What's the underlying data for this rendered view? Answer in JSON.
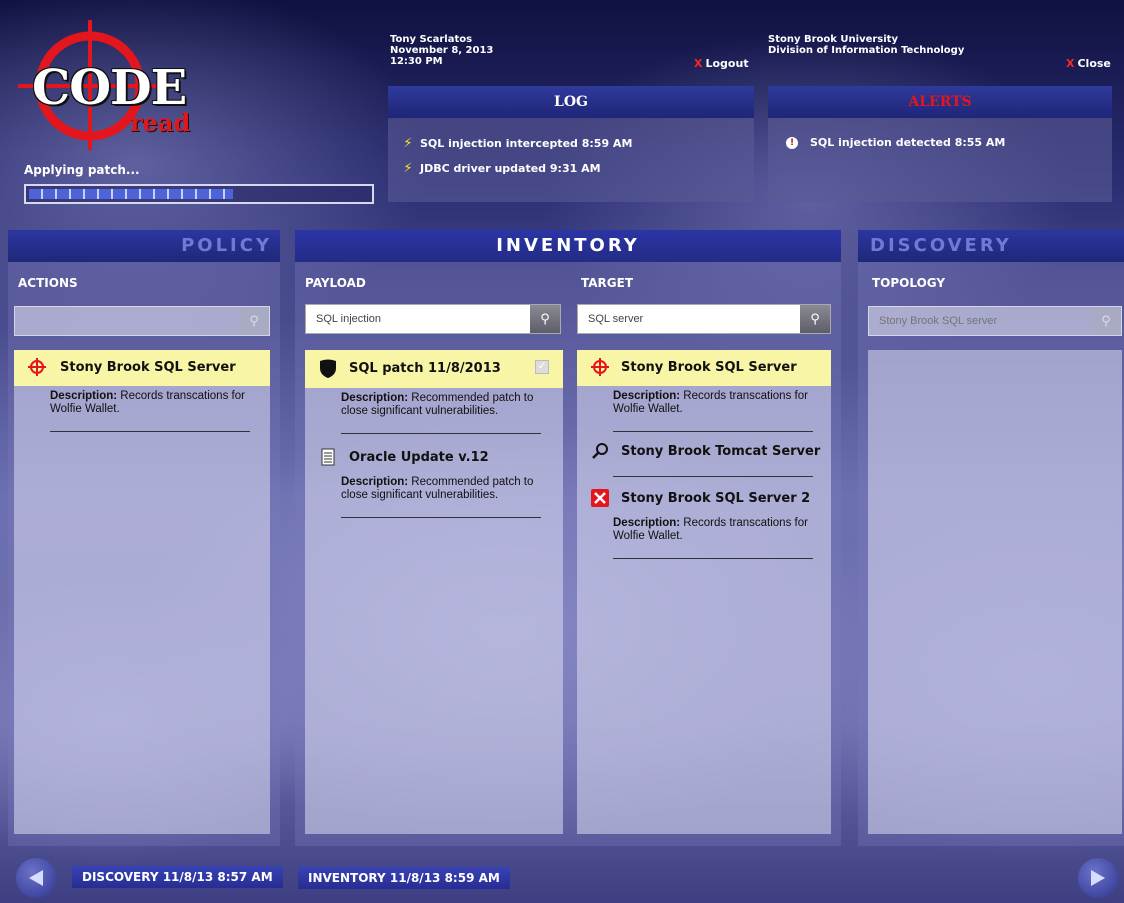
{
  "logo": {
    "word": "CODE",
    "sub": "read"
  },
  "status": {
    "text": "Applying patch...",
    "progress": 0.6
  },
  "user": {
    "name": "Tony Scarlatos",
    "date": "November 8, 2013",
    "time": "12:30 PM",
    "logout_label": "Logout"
  },
  "org": {
    "name": "Stony Brook University",
    "division": "Division of Information Technology",
    "close_label": "Close"
  },
  "log": {
    "title": "LOG",
    "items": [
      {
        "text": "SQL injection intercepted 8:59 AM",
        "icon": "lightning-icon"
      },
      {
        "text": "JDBC driver updated 9:31 AM",
        "icon": "lightning-icon"
      }
    ]
  },
  "alerts": {
    "title": "ALERTS",
    "items": [
      {
        "text": "SQL injection detected 8:55 AM",
        "icon": "alert-icon"
      }
    ]
  },
  "policy": {
    "title": "POLICY",
    "section": "ACTIONS",
    "search_value": "",
    "items": [
      {
        "title": "Stony Brook SQL Server",
        "desc_label": "Description:",
        "desc_text": "Records transcations for Wolfie Wallet."
      }
    ]
  },
  "inventory": {
    "title": "INVENTORY",
    "payload": {
      "section": "PAYLOAD",
      "search_value": "SQL injection",
      "items": [
        {
          "title": "SQL patch 11/8/2013",
          "desc_label": "Description:",
          "desc_text": "Recommended patch to close significant vulnerabilities.",
          "icon": "shield-icon"
        },
        {
          "title": "Oracle Update v.12",
          "desc_label": "Description:",
          "desc_text": "Recommended patch to close significant vulnerabilities.",
          "icon": "document-icon"
        }
      ]
    },
    "target": {
      "section": "TARGET",
      "search_value": "SQL server",
      "items": [
        {
          "title": "Stony Brook SQL Server",
          "desc_label": "Description:",
          "desc_text": "Records transcations for Wolfie Wallet.",
          "icon": "crosshair-icon"
        },
        {
          "title": "Stony Brook Tomcat Server",
          "icon": "magnifier-icon"
        },
        {
          "title": "Stony Brook SQL Server 2",
          "desc_label": "Description:",
          "desc_text": "Records transcations for Wolfie Wallet.",
          "icon": "red-x-icon"
        }
      ]
    }
  },
  "discovery": {
    "title": "DISCOVERY",
    "section": "TOPOLOGY",
    "search_placeholder": "Stony Brook SQL server"
  },
  "footer": {
    "discovery_tag": "DISCOVERY  11/8/13 8:57 AM",
    "inventory_tag": "INVENTORY 11/8/13 8:59 AM"
  },
  "colors": {
    "accent": "#232c86",
    "alert": "#e4161d",
    "highlight": "#f8f5a6"
  }
}
